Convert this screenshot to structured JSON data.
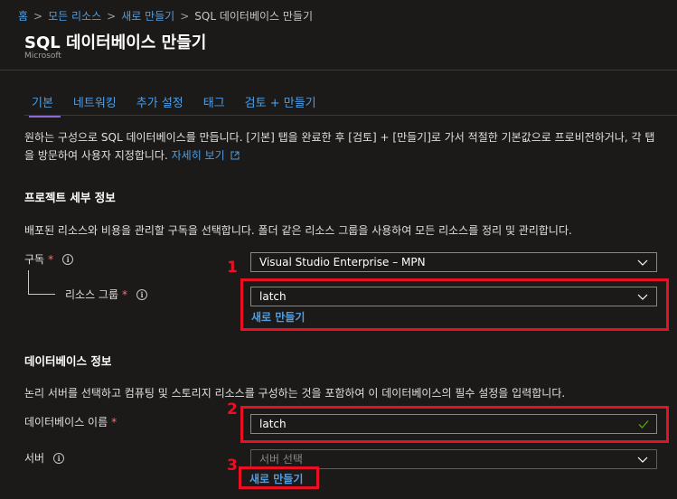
{
  "breadcrumb": {
    "items": [
      "홈",
      "모든 리소스",
      "새로 만들기",
      "SQL 데이터베이스 만들기"
    ],
    "separator": ">"
  },
  "header": {
    "title": "SQL 데이터베이스 만들기",
    "subtitle": "Microsoft"
  },
  "tabs": [
    {
      "label": "기본",
      "active": true
    },
    {
      "label": "네트워킹",
      "active": false
    },
    {
      "label": "추가 설정",
      "active": false
    },
    {
      "label": "태그",
      "active": false
    },
    {
      "label": "검토 + 만들기",
      "active": false
    }
  ],
  "intro": {
    "text": "원하는 구성으로 SQL 데이터베이스를 만듭니다. [기본] 탭을 완료한 후 [검토] + [만들기]로 가서 적절한 기본값으로 프로비전하거나, 각 탭을 방문하여 사용자 지정합니다.",
    "link": "자세히 보기"
  },
  "project": {
    "heading": "프로젝트 세부 정보",
    "description": "배포된 리소스와 비용을 관리할 구독을 선택합니다. 폴더 같은 리소스 그룹을 사용하여 모든 리소스를 정리 및 관리합니다.",
    "subscription": {
      "label": "구독",
      "required": "*",
      "value": "Visual Studio Enterprise – MPN"
    },
    "resource_group": {
      "label": "리소스 그룹",
      "required": "*",
      "value": "latch",
      "create_new": "새로 만들기"
    }
  },
  "database": {
    "heading": "데이터베이스 정보",
    "description": "논리 서버를 선택하고 컴퓨팅 및 스토리지 리소스를 구성하는 것을 포함하여 이 데이터베이스의 필수 설정을 입력합니다.",
    "name": {
      "label": "데이터베이스 이름",
      "required": "*",
      "value": "latch"
    },
    "server": {
      "label": "서버",
      "placeholder": "서버 선택",
      "create_new": "새로 만들기"
    }
  },
  "annotations": {
    "one": "1",
    "two": "2",
    "three": "3"
  },
  "colors": {
    "background": "#1b1a19",
    "accent": "#4f9ee3",
    "tab_underline": "#8a6bd6",
    "highlight": "#e81123",
    "required": "#f1707b",
    "valid": "#57a300"
  }
}
